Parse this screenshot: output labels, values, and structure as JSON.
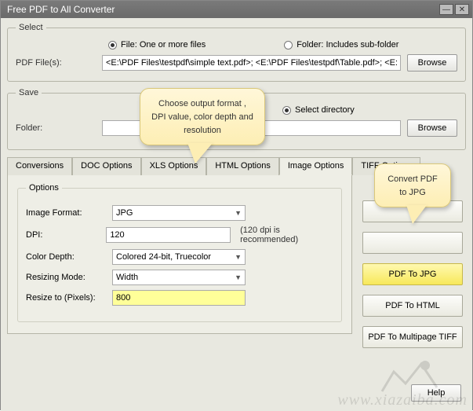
{
  "window": {
    "title": "Free PDF to All Converter"
  },
  "select": {
    "legend": "Select",
    "file_radio": "File:  One or more files",
    "folder_radio": "Folder: Includes sub-folder",
    "pdf_files_label": "PDF File(s):",
    "pdf_files_value": "<E:\\PDF Files\\testpdf\\simple text.pdf>; <E:\\PDF Files\\testpdf\\Table.pdf>; <E:\\PDF",
    "browse": "Browse"
  },
  "save": {
    "legend": "Save",
    "select_dir_radio": "Select directory",
    "folder_label": "Folder:",
    "folder_value": "",
    "browse": "Browse"
  },
  "tabs": {
    "t0": "Conversions",
    "t1": "DOC Options",
    "t2": "XLS Options",
    "t3": "HTML Options",
    "t4": "Image Options",
    "t5": "TIFF Options"
  },
  "imageopts": {
    "legend": "Options",
    "format_label": "Image Format:",
    "format_value": "JPG",
    "dpi_label": "DPI:",
    "dpi_value": "120",
    "dpi_hint": "(120 dpi is recommended)",
    "depth_label": "Color Depth:",
    "depth_value": "Colored 24-bit, Truecolor",
    "resize_mode_label": "Resizing Mode:",
    "resize_mode_value": "Width",
    "resize_px_label": "Resize to (Pixels):",
    "resize_px_value": "800"
  },
  "rightbtns": {
    "pdf_to_jpg": "PDF To JPG",
    "pdf_to_html": "PDF To HTML",
    "pdf_to_tiff": "PDF To Multipage TIFF"
  },
  "help": "Help",
  "callout1": "Choose output format , DPI value, color depth and resolution",
  "callout2": "Convert PDF to JPG",
  "watermark": "www.xiazaiba.com"
}
